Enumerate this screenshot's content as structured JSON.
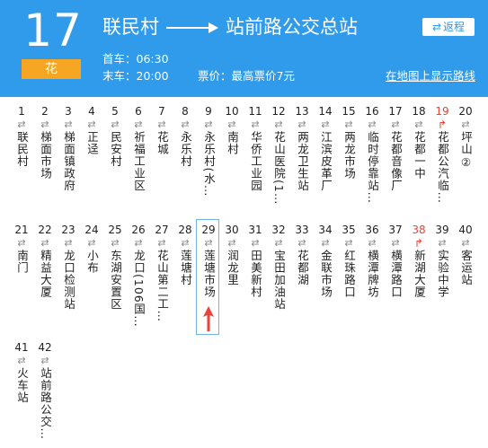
{
  "route": {
    "number": "17",
    "tag": "花",
    "origin": "联民村",
    "destination": "站前路公交总站",
    "return_label": "返程",
    "first_bus": "首车：06:30",
    "last_bus": "末车：20:00",
    "fare": "票价：最高票价7元",
    "map_link": "在地图上显示路线"
  },
  "current_stop": "29",
  "stops": [
    {
      "num": "1",
      "name": "联民村"
    },
    {
      "num": "2",
      "name": "梯面市场"
    },
    {
      "num": "3",
      "name": "梯面镇政府"
    },
    {
      "num": "4",
      "name": "正迳"
    },
    {
      "num": "5",
      "name": "民安村"
    },
    {
      "num": "6",
      "name": "祈福工业区"
    },
    {
      "num": "7",
      "name": "花城"
    },
    {
      "num": "8",
      "name": "永乐村"
    },
    {
      "num": "9",
      "name": "永乐村(水…"
    },
    {
      "num": "10",
      "name": "南村"
    },
    {
      "num": "11",
      "name": "华侨工业园"
    },
    {
      "num": "12",
      "name": "花山医院(1…"
    },
    {
      "num": "13",
      "name": "两龙卫生站"
    },
    {
      "num": "14",
      "name": "江滨皮革厂"
    },
    {
      "num": "15",
      "name": "两龙市场"
    },
    {
      "num": "16",
      "name": "临时停靠站…"
    },
    {
      "num": "17",
      "name": "花都音像厂"
    },
    {
      "num": "18",
      "name": "花都一中"
    },
    {
      "num": "19",
      "name": "花都公汽临…",
      "red": true
    },
    {
      "num": "20",
      "name": "坪山②"
    },
    {
      "num": "21",
      "name": "南门"
    },
    {
      "num": "22",
      "name": "精益大厦"
    },
    {
      "num": "23",
      "name": "龙口检测站"
    },
    {
      "num": "24",
      "name": "小布"
    },
    {
      "num": "25",
      "name": "东湖安置区"
    },
    {
      "num": "26",
      "name": "龙口(106国…"
    },
    {
      "num": "27",
      "name": "花山第二工…"
    },
    {
      "num": "28",
      "name": "莲塘村"
    },
    {
      "num": "29",
      "name": "莲塘市场"
    },
    {
      "num": "30",
      "name": "润龙里"
    },
    {
      "num": "31",
      "name": "田美新村"
    },
    {
      "num": "32",
      "name": "宝田加油站"
    },
    {
      "num": "33",
      "name": "花都湖"
    },
    {
      "num": "34",
      "name": "金联市场"
    },
    {
      "num": "35",
      "name": "红珠路口"
    },
    {
      "num": "36",
      "name": "横潭牌坊"
    },
    {
      "num": "37",
      "name": "横潭路口"
    },
    {
      "num": "38",
      "name": "新湖大厦",
      "red": true
    },
    {
      "num": "39",
      "name": "实验中学"
    },
    {
      "num": "40",
      "name": "客运站"
    },
    {
      "num": "41",
      "name": "火车站"
    },
    {
      "num": "42",
      "name": "站前路公交…"
    }
  ]
}
